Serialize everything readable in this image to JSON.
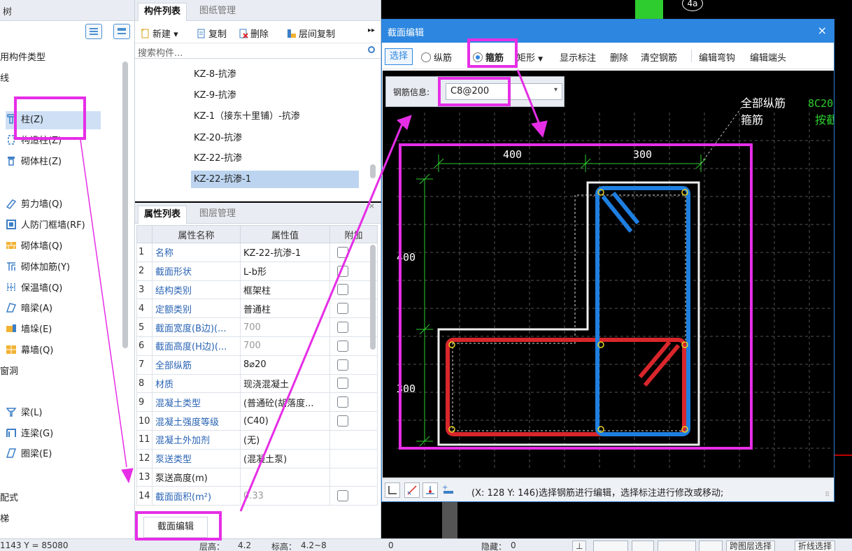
{
  "left_panel": {
    "header": "树",
    "items": [
      {
        "label": "用构件类型"
      },
      {
        "label": "线"
      },
      {
        "label": "柱(Z)"
      },
      {
        "label": "构造柱(Z)"
      },
      {
        "label": "砌体柱(Z)"
      },
      {
        "label": "剪力墙(Q)"
      },
      {
        "label": "人防门框墙(RF)"
      },
      {
        "label": "砌体墙(Q)"
      },
      {
        "label": "砌体加筋(Y)"
      },
      {
        "label": "保温墙(Q)"
      },
      {
        "label": "暗梁(A)"
      },
      {
        "label": "墙垛(E)"
      },
      {
        "label": "幕墙(Q)"
      },
      {
        "label": "窗洞"
      },
      {
        "label": "梁(L)"
      },
      {
        "label": "连梁(G)"
      },
      {
        "label": "圈梁(E)"
      },
      {
        "label": "配式"
      },
      {
        "label": "梯"
      }
    ]
  },
  "component_panel": {
    "tabs": [
      "构件列表",
      "图纸管理"
    ],
    "toolbar": {
      "new": "新建",
      "copy": "复制",
      "delete": "删除",
      "floor_copy": "层间复制"
    },
    "search_placeholder": "搜索构件...",
    "items": [
      "KZ-8-抗渗",
      "KZ-9-抗渗",
      "KZ-1（接东十里铺）-抗渗",
      "KZ-20-抗渗",
      "KZ-22-抗渗",
      "KZ-22-抗渗-1"
    ]
  },
  "property_panel": {
    "tabs": [
      "属性列表",
      "图层管理"
    ],
    "columns": [
      "属性名称",
      "属性值",
      "附加"
    ],
    "rows": [
      {
        "n": "1",
        "name": "名称",
        "value": "KZ-22-抗渗-1"
      },
      {
        "n": "2",
        "name": "截面形状",
        "value": "L-b形"
      },
      {
        "n": "3",
        "name": "结构类别",
        "value": "框架柱"
      },
      {
        "n": "4",
        "name": "定额类别",
        "value": "普通柱"
      },
      {
        "n": "5",
        "name": "截面宽度(B边)(...",
        "value": "700"
      },
      {
        "n": "6",
        "name": "截面高度(H边)(...",
        "value": "700"
      },
      {
        "n": "7",
        "name": "全部纵筋",
        "value": "8⌀20"
      },
      {
        "n": "8",
        "name": "材质",
        "value": "现浇混凝土"
      },
      {
        "n": "9",
        "name": "混凝土类型",
        "value": "(普通砼(胡落度..."
      },
      {
        "n": "10",
        "name": "混凝土强度等级",
        "value": "(C40)"
      },
      {
        "n": "11",
        "name": "混凝土外加剂",
        "value": "(无)"
      },
      {
        "n": "12",
        "name": "泵送类型",
        "value": "(混凝土泵)"
      },
      {
        "n": "13",
        "name": "泵送高度(m)",
        "value": ""
      },
      {
        "n": "14",
        "name": "截面面积(m²)",
        "value": "0.33"
      }
    ],
    "section_edit_button": "截面编辑"
  },
  "dialog": {
    "title": "截面编辑",
    "close": "×",
    "toolbar": {
      "select": "选择",
      "longitudinal": "纵筋",
      "stirrup": "箍筋",
      "shape": "矩形",
      "show_dims": "显示标注",
      "delete": "删除",
      "clear": "清空钢筋",
      "edit_hook": "编辑弯钩",
      "edit_end": "编辑端头"
    },
    "rebar_info_label": "钢筋信息:",
    "rebar_info_value": "C8@200",
    "canvas": {
      "dim_top_1": "400",
      "dim_top_2": "300",
      "dim_left_1": "400",
      "dim_left_2": "300",
      "legend_all": "全部纵筋",
      "legend_all_val": "8C20",
      "legend_stirrup": "箍筋",
      "legend_stirrup_val": "按截"
    },
    "status": "(X: 128 Y: 146)选择钢筋进行编辑，选择标注进行修改或移动;"
  },
  "background": {
    "axis_label": "4a"
  },
  "bottom_strip": {
    "coords": "1143 Y = 85080",
    "floor_height_label": "层高：",
    "floor_height": "4.2",
    "elevation_label": "标高：",
    "elevation": "4.2~8",
    "zero": "0",
    "hidden_label": "隐藏：",
    "hidden": "0",
    "layer_select": "跨图层选择",
    "fold_select": "折线选择"
  },
  "colors": {
    "accent": "#2d87e0",
    "annotation": "#e62ee6",
    "rebar_red": "#d9262b",
    "rebar_blue": "#1e7fe0"
  }
}
